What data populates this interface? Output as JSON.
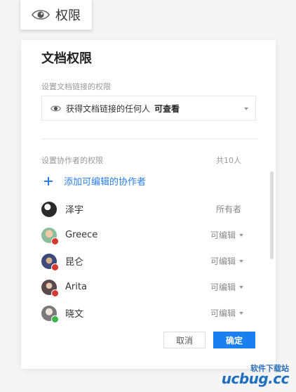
{
  "permission_button": {
    "label": "权限",
    "icon": "eye-icon"
  },
  "dialog": {
    "title": "文档权限",
    "link_section_label": "设置文档链接的权限",
    "link_select": {
      "value": "获得文档链接的任何人",
      "permission": "可查看",
      "icon": "eye-icon"
    },
    "collab_section_label": "设置协作者的权限",
    "collab_count": "共10人",
    "add_collaborator_label": "添加可编辑的协作者",
    "collaborators": [
      {
        "name": "泽宇",
        "role": "所有者",
        "has_dropdown": false
      },
      {
        "name": "Greece",
        "role": "可编辑",
        "has_dropdown": true
      },
      {
        "name": "昆仑",
        "role": "可编辑",
        "has_dropdown": true
      },
      {
        "name": "Arita",
        "role": "可编辑",
        "has_dropdown": true
      },
      {
        "name": "晓文",
        "role": "可编辑",
        "has_dropdown": true
      }
    ],
    "cancel_label": "取消",
    "confirm_label": "确定"
  },
  "watermark": {
    "top": "软件下载站",
    "main": "ucbug.cc"
  },
  "colors": {
    "accent": "#1a80f0",
    "link": "#2b7ff0",
    "muted": "#999999"
  }
}
